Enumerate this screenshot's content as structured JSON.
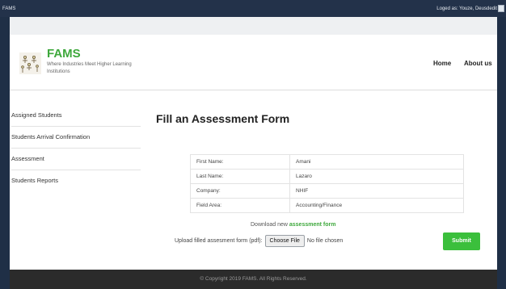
{
  "topbar": {
    "brand": "FAMS",
    "user_text": "Loged as: Youze, Deusdedit"
  },
  "header": {
    "logo_title": "FAMS",
    "logo_subtitle": "Where Industries Meet Higher Learning Institutions",
    "nav": {
      "home": "Home",
      "about": "About us"
    }
  },
  "sidebar": {
    "items": [
      {
        "label": "Assigned Students"
      },
      {
        "label": "Students Arrival Confirmation"
      },
      {
        "label": "Assessment"
      },
      {
        "label": "Students Reports"
      }
    ]
  },
  "main": {
    "title": "Fill an Assessment Form",
    "rows": [
      {
        "key": "First Name:",
        "value": "Amani"
      },
      {
        "key": "Last Name:",
        "value": "Lazaro"
      },
      {
        "key": "Company:",
        "value": "NHIF"
      },
      {
        "key": "Field Area:",
        "value": "Accounting/Finance"
      }
    ],
    "download_prefix": "Download new",
    "download_link": "assessment form",
    "upload_label": "Upload filled assesment form (pdf):",
    "file_button": "Choose File",
    "file_status": "No file chosen",
    "submit": "Submit"
  },
  "footer": {
    "text": "© Copyright 2019 FAMS. All Rights Reserved."
  },
  "colors": {
    "brand_green": "#3ea83c",
    "submit_green": "#3bbf3c",
    "topbar": "#23324a",
    "footer": "#2b2b2b"
  }
}
